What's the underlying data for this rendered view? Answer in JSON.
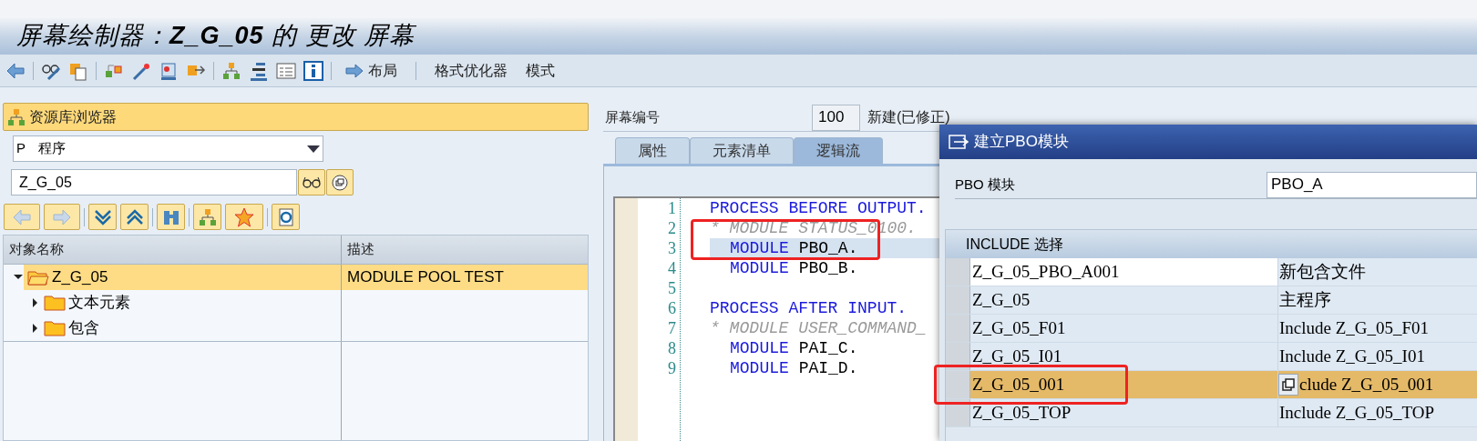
{
  "window": {
    "title": "屏幕绘制器：**Z_G_05** 的 更改 屏幕"
  },
  "toolbar": {
    "text_buttons": [
      {
        "label": "布局",
        "kind": "arrow"
      },
      {
        "label": "格式优化器",
        "kind": "plain"
      },
      {
        "label": "模式",
        "kind": "plain"
      }
    ]
  },
  "repository_browser": {
    "title": "资源库浏览器",
    "object_type": {
      "code": "P",
      "label": "程序"
    },
    "object_name": "Z_G_05",
    "columns": [
      "对象名称",
      "描述"
    ],
    "tree": [
      {
        "label": "Z_G_05",
        "description": "MODULE POOL TEST",
        "expanded": true,
        "selected": true,
        "children": [
          {
            "label": "文本元素",
            "expanded": false,
            "selected": false
          },
          {
            "label": "包含",
            "expanded": false,
            "selected": false
          }
        ]
      }
    ]
  },
  "screen": {
    "number_label": "屏幕编号",
    "number": "100",
    "status": "新建(已修正)",
    "tabs": [
      {
        "label": "属性",
        "selected": false
      },
      {
        "label": "元素清单",
        "selected": false
      },
      {
        "label": "逻辑流",
        "selected": true
      }
    ],
    "code_lines": [
      {
        "number": "1",
        "kind": "statement",
        "text": "PROCESS BEFORE OUTPUT.",
        "highlighted": false
      },
      {
        "number": "2",
        "kind": "comment",
        "text": "* MODULE STATUS_0100.",
        "highlighted": false
      },
      {
        "number": "3",
        "kind": "module",
        "keyword": "MODULE",
        "text": "PBO_A.",
        "highlighted": true
      },
      {
        "number": "4",
        "kind": "module",
        "keyword": "MODULE",
        "text": "PBO_B.",
        "highlighted": false
      },
      {
        "number": "5",
        "kind": "blank",
        "highlighted": false
      },
      {
        "number": "6",
        "kind": "statement",
        "text": "PROCESS AFTER INPUT.",
        "highlighted": false
      },
      {
        "number": "7",
        "kind": "comment",
        "text": "* MODULE USER_COMMAND_",
        "highlighted": false
      },
      {
        "number": "8",
        "kind": "module",
        "keyword": "MODULE",
        "text": "PAI_C.",
        "highlighted": false
      },
      {
        "number": "9",
        "kind": "module",
        "keyword": "MODULE",
        "text": "PAI_D.",
        "highlighted": false
      }
    ]
  },
  "dialog": {
    "title": "建立PBO模块",
    "field_label": "PBO 模块",
    "field_value": "PBO_A",
    "table_title": "INCLUDE 选择",
    "rows": [
      {
        "name": "Z_G_05_PBO_A001",
        "description": "新包含文件",
        "selected": false,
        "current": true,
        "value_help": false
      },
      {
        "name": "Z_G_05",
        "description": "主程序",
        "selected": false,
        "current": false,
        "value_help": false
      },
      {
        "name": "Z_G_05_F01",
        "description": "Include Z_G_05_F01",
        "selected": false,
        "current": false,
        "value_help": false
      },
      {
        "name": "Z_G_05_I01",
        "description": "Include Z_G_05_I01",
        "selected": false,
        "current": false,
        "value_help": false
      },
      {
        "name": "Z_G_05_001",
        "description": "clude Z_G_05_001",
        "selected": true,
        "current": false,
        "value_help": true
      },
      {
        "name": "Z_G_05_TOP",
        "description": "Include Z_G_05_TOP",
        "selected": false,
        "current": false,
        "value_help": false
      }
    ]
  }
}
